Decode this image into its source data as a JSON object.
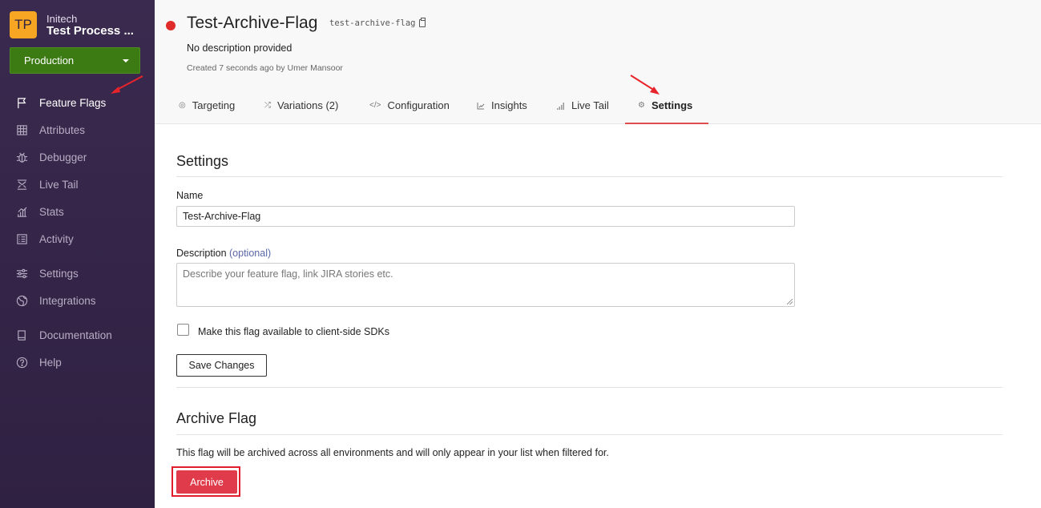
{
  "sidebar": {
    "org_avatar": "TP",
    "org_name": "Initech",
    "project_name": "Test Process ...",
    "environment": "Production",
    "items": [
      {
        "label": "Feature Flags",
        "icon": "flag-icon"
      },
      {
        "label": "Attributes",
        "icon": "table-icon"
      },
      {
        "label": "Debugger",
        "icon": "bug-icon"
      },
      {
        "label": "Live Tail",
        "icon": "live-tail-icon"
      },
      {
        "label": "Stats",
        "icon": "stats-icon"
      },
      {
        "label": "Activity",
        "icon": "list-icon"
      },
      {
        "label": "Settings",
        "icon": "sliders-icon"
      },
      {
        "label": "Integrations",
        "icon": "globe-icon"
      },
      {
        "label": "Documentation",
        "icon": "book-icon"
      },
      {
        "label": "Help",
        "icon": "help-icon"
      }
    ]
  },
  "flag": {
    "title": "Test-Archive-Flag",
    "key": "test-archive-flag",
    "description": "No description provided",
    "created": "Created 7 seconds ago by Umer Mansoor",
    "status_color": "#e02b2b"
  },
  "tabs": [
    {
      "label": "Targeting",
      "icon": "target-icon"
    },
    {
      "label": "Variations (2)",
      "icon": "shuffle-icon"
    },
    {
      "label": "Configuration",
      "icon": "code-icon"
    },
    {
      "label": "Insights",
      "icon": "chart-icon"
    },
    {
      "label": "Live Tail",
      "icon": "signal-icon"
    },
    {
      "label": "Settings",
      "icon": "gear-icon"
    }
  ],
  "settings": {
    "heading": "Settings",
    "name_label": "Name",
    "name_value": "Test-Archive-Flag",
    "description_label": "Description",
    "description_optional": "(optional)",
    "description_placeholder": "Describe your feature flag, link JIRA stories etc.",
    "client_side_label": "Make this flag available to client-side SDKs",
    "save_label": "Save Changes"
  },
  "archive": {
    "heading": "Archive Flag",
    "description": "This flag will be archived across all environments and will only appear in your list when filtered for.",
    "button_label": "Archive",
    "button_color": "#e03b4b"
  }
}
